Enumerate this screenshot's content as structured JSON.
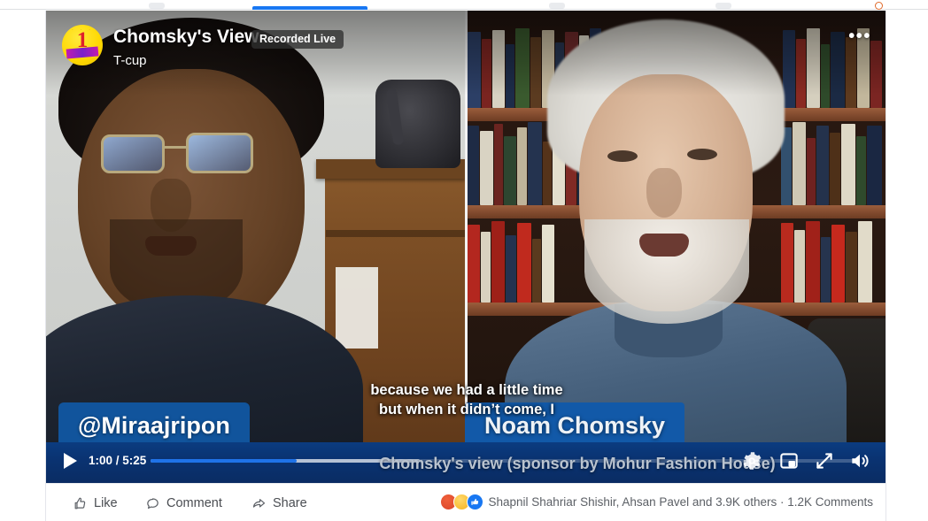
{
  "browser_nav": {
    "active_tab_indicator": "watch-tab-active",
    "accent_color": "#1877f2"
  },
  "video": {
    "channel_name": "Chomsky's View",
    "live_badge": "Recorded Live",
    "subtitle": "T-cup",
    "options_icon": "•••",
    "avatar_icon": "channel-logo-number-one",
    "avatar_number": "1",
    "avatar_dots": "· · ·",
    "title_overlay": "Chomsky's view (sponsor by Mohur Fashion House)",
    "captions": [
      "because we had a little time",
      "but when it didn’t come, I"
    ],
    "nametags": {
      "left": "@Miraajripon",
      "right": "Noam Chomsky"
    },
    "controls": {
      "play_icon": "play-icon",
      "current_time": "1:00",
      "duration": "5:25",
      "time_display": "1:00 / 5:25",
      "progress_percent": 20.6,
      "buffered_percent": 38,
      "settings_icon": "gear-icon",
      "miniplayer_icon": "miniplayer-icon",
      "expand_icon": "expand-icon",
      "volume_icon": "volume-on-icon",
      "progress_color": "#1f73e8",
      "bar_color": "#0a3372"
    }
  },
  "footer": {
    "actions": [
      {
        "label": "Like",
        "icon": "thumbs-up-icon"
      },
      {
        "label": "Comment",
        "icon": "comment-bubble-icon"
      },
      {
        "label": "Share",
        "icon": "share-arrow-icon"
      }
    ],
    "reactions": {
      "icons": [
        "angry-reaction-icon",
        "haha-reaction-icon",
        "like-reaction-icon"
      ],
      "angry_glyph": "·",
      "haha_glyph": "·",
      "summary_text": "Shapnil Shahriar Shishir, Ahsan Pavel and 3.9K others · 1.2K Comments",
      "names": "Shapnil Shahriar Shishir, Ahsan Pavel",
      "others_count": "3.9K others",
      "comments_count": "1.2K Comments"
    }
  }
}
